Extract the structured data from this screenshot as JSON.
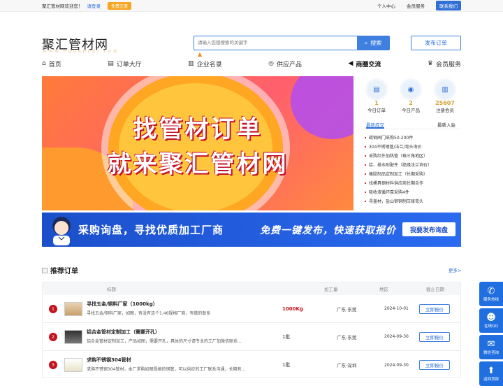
{
  "topbar": {
    "welcome": "聚汇管材网欢迎您！",
    "login": "请登录",
    "register": "免费注册",
    "personal": "个人中心",
    "member": "会员服务",
    "contact": "联系我们"
  },
  "header": {
    "logo": "聚汇管材网",
    "logo_sub": "www.eguancai.com",
    "search_placeholder": "请输入您想搜索的关键字",
    "search_button": "搜索",
    "publish": "发布订单"
  },
  "nav": [
    {
      "label": "首页",
      "icon": "home-icon"
    },
    {
      "label": "订单大厅",
      "icon": "doc-icon"
    },
    {
      "label": "企业名录",
      "icon": "building-icon"
    },
    {
      "label": "供应产品",
      "icon": "product-icon"
    },
    {
      "label": "商圈交流",
      "icon": "megaphone-icon",
      "active": true
    },
    {
      "label": "会员服务",
      "icon": "crown-icon"
    }
  ],
  "banner": {
    "line1": "找管材订单",
    "line2": "就来聚汇管材网"
  },
  "stats": [
    {
      "num": "1",
      "label": "今日订单"
    },
    {
      "num": "2",
      "label": "今日产品"
    },
    {
      "num": "25607",
      "label": "注册会员"
    }
  ],
  "tabs": {
    "latest": "最新成交",
    "new_member": "最新入驻"
  },
  "latest": [
    "碳钢阀门采购50-200件",
    "304不锈钢管/法兰/弯头询价",
    "采购红外加热管（珠三角地区）",
    "给、排水附配件（绝缘法兰询价）",
    "橡胶制品定制加工（长期采购）",
    "找模具钢材料供应商长期合作",
    "吸收液循环泵采购4件",
    "寻盖材，盐山钢铜制压接弯头"
  ],
  "banner2": {
    "left": "采购询盘，寻找优质加工厂商",
    "right": "免费一键发布，快速获取报价",
    "button": "我要发布询盘"
  },
  "section": {
    "title": "推荐订单",
    "more": "更多>"
  },
  "table": {
    "headers": [
      "标题",
      "加工量",
      "地区",
      "截止日期"
    ],
    "rows": [
      {
        "idx": "1",
        "title": "寻找五金/铜料厂家（1000kg）",
        "desc": "寻找五金/铜料厂家，如图，有没有这个1.46规格厂商，有做的联系",
        "qty_num": "1000",
        "qty_unit": "Kg",
        "area": "广东-东莞",
        "date": "2024-10-01",
        "quote": "立即报价"
      },
      {
        "idx": "2",
        "title": "铝合金管材定制加工（需要开孔）",
        "desc": "铝合金管材定制加工，产品如图，需要开孔，具体的尺寸请专业的工厂加微信联系...",
        "qty_num": "1",
        "qty_unit": "批",
        "area": "广东-东莞",
        "date": "2024-09-30",
        "quote": "立即报价"
      },
      {
        "idx": "3",
        "title": "求购不锈钢304管材",
        "desc": "求购不锈钢304管材，本厂求购如图规格的钢管，可以供应的工厂联系沟通，长期有...",
        "qty_num": "1",
        "qty_unit": "批",
        "area": "广东-深圳",
        "date": "2024-09-30",
        "quote": "立即报价"
      }
    ]
  },
  "side": [
    {
      "label": "服务热线",
      "icon": "phone-icon"
    },
    {
      "label": "在线QQ",
      "icon": "qq-icon"
    },
    {
      "label": "微信咨询",
      "icon": "wechat-icon"
    },
    {
      "label": "返回顶部",
      "icon": "arrow-up-icon"
    }
  ]
}
